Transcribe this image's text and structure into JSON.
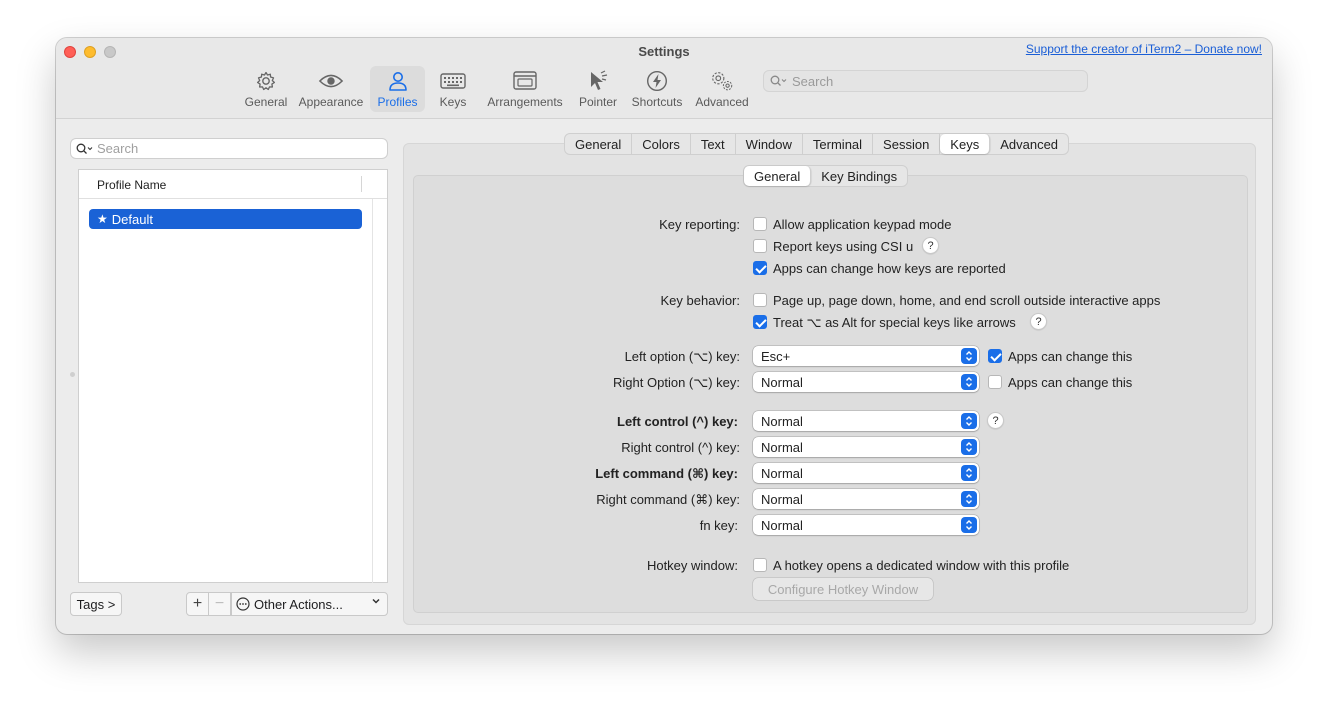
{
  "window": {
    "title": "Settings",
    "donate_link": "Support the creator of iTerm2 – Donate now!"
  },
  "toolbar": {
    "items": [
      {
        "label": "General",
        "icon": "gear-icon"
      },
      {
        "label": "Appearance",
        "icon": "eye-icon"
      },
      {
        "label": "Profiles",
        "icon": "person-icon",
        "active": true
      },
      {
        "label": "Keys",
        "icon": "keyboard-icon"
      },
      {
        "label": "Arrangements",
        "icon": "window-arrangement-icon"
      },
      {
        "label": "Pointer",
        "icon": "pointer-icon"
      },
      {
        "label": "Shortcuts",
        "icon": "lightning-icon"
      },
      {
        "label": "Advanced",
        "icon": "gears-icon"
      }
    ],
    "search_placeholder": "Search"
  },
  "sidebar": {
    "search_placeholder": "Search",
    "column_header": "Profile Name",
    "profiles": [
      {
        "name": "Default",
        "selected": true
      }
    ],
    "tags_button": "Tags >",
    "add_button": "+",
    "remove_button": "−",
    "other_actions": "Other Actions..."
  },
  "profile_tabs": {
    "items": [
      "General",
      "Colors",
      "Text",
      "Window",
      "Terminal",
      "Session",
      "Keys",
      "Advanced"
    ],
    "active": "Keys"
  },
  "sub_tabs": {
    "items": [
      "General",
      "Key Bindings"
    ],
    "active": "General"
  },
  "key_reporting": {
    "label": "Key reporting:",
    "options": [
      {
        "label": "Allow application keypad mode",
        "checked": false
      },
      {
        "label": "Report keys using CSI u",
        "checked": false,
        "help": true
      },
      {
        "label": "Apps can change how keys are reported",
        "checked": true
      }
    ]
  },
  "key_behavior": {
    "label": "Key behavior:",
    "options": [
      {
        "label": "Page up, page down, home, and end scroll outside interactive apps",
        "checked": false
      },
      {
        "label": "Treat ⌥ as Alt for special keys like arrows",
        "checked": true,
        "help": true
      }
    ]
  },
  "modifiers": [
    {
      "label": "Left option (⌥) key:",
      "value": "Esc+",
      "bold": false,
      "apps_change": {
        "label": "Apps can change this",
        "checked": true
      }
    },
    {
      "label": "Right Option (⌥) key:",
      "value": "Normal",
      "bold": false,
      "apps_change": {
        "label": "Apps can change this",
        "checked": false
      }
    },
    {
      "label": "Left control (^) key:",
      "value": "Normal",
      "bold": true,
      "help": true
    },
    {
      "label": "Right control (^) key:",
      "value": "Normal",
      "bold": false
    },
    {
      "label": "Left command (⌘) key:",
      "value": "Normal",
      "bold": true
    },
    {
      "label": "Right command (⌘) key:",
      "value": "Normal",
      "bold": false
    },
    {
      "label": "fn key:",
      "value": "Normal",
      "bold": false
    }
  ],
  "hotkey": {
    "label": "Hotkey window:",
    "checkbox_label": "A hotkey opens a dedicated window with this profile",
    "checked": false,
    "configure_button": "Configure Hotkey Window"
  },
  "help_glyph": "?",
  "colors": {
    "accent": "#1a6ee8",
    "selection": "#1a62d6",
    "link": "#1a5ed6"
  }
}
